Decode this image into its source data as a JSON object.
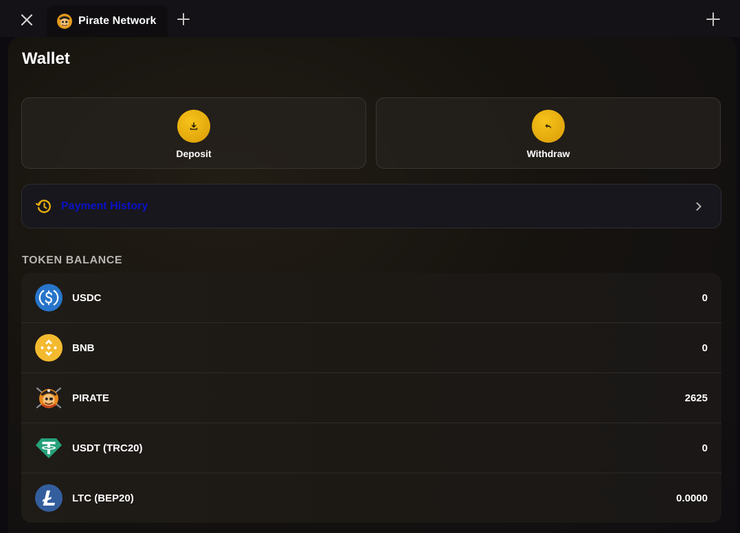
{
  "titlebar": {
    "tab_title": "Pirate Network",
    "icons": {
      "close": "close-icon",
      "new_tab": "plus-icon",
      "expand": "expand-icon"
    }
  },
  "page": {
    "title": "Wallet"
  },
  "actions": {
    "deposit_label": "Deposit",
    "withdraw_label": "Withdraw",
    "accent_color": "#e8ae0e"
  },
  "payment_history": {
    "label": "Payment History",
    "label_color": "#0a12c8",
    "icon_color": "#e8ae0e"
  },
  "token_balance": {
    "section_title": "TOKEN BALANCE",
    "tokens": [
      {
        "name": "USDC",
        "value": "0",
        "icon": "usdc-icon"
      },
      {
        "name": "BNB",
        "value": "0",
        "icon": "bnb-icon"
      },
      {
        "name": "PIRATE",
        "value": "2625",
        "icon": "pirate-icon"
      },
      {
        "name": "USDT (TRC20)",
        "value": "0",
        "icon": "usdt-icon"
      },
      {
        "name": "LTC (BEP20)",
        "value": "0.0000",
        "icon": "ltc-icon"
      }
    ]
  }
}
